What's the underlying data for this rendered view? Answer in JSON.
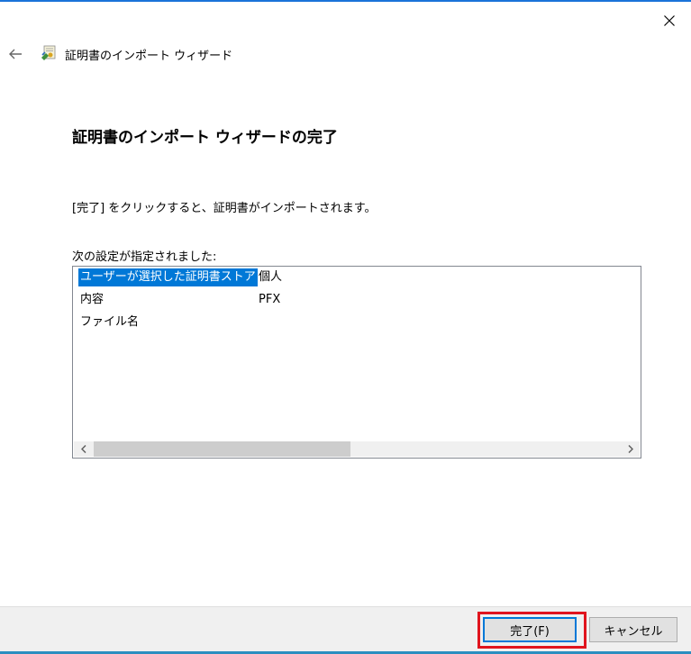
{
  "wizard": {
    "title": "証明書のインポート ウィザード",
    "back_icon": "back-arrow-icon",
    "close_icon": "close-icon",
    "app_icon": "certificate-wizard-icon"
  },
  "page": {
    "heading": "証明書のインポート ウィザードの完了",
    "instruction": "[完了] をクリックすると、証明書がインポートされます。",
    "settings_label": "次の設定が指定されました:"
  },
  "settings": {
    "rows": [
      {
        "key": "ユーザーが選択した証明書ストア",
        "value": "個人"
      },
      {
        "key": "内容",
        "value": "PFX"
      },
      {
        "key": "ファイル名",
        "value": ""
      }
    ],
    "scrollbar": {
      "left_icon": "chevron-left-icon",
      "right_icon": "chevron-right-icon"
    }
  },
  "buttons": {
    "finish_label": "完了(F)",
    "cancel_label": "キャンセル"
  },
  "colors": {
    "selection": "#0078d7",
    "highlight": "#e0141e",
    "title_bar_accent": "#1a73d9"
  }
}
